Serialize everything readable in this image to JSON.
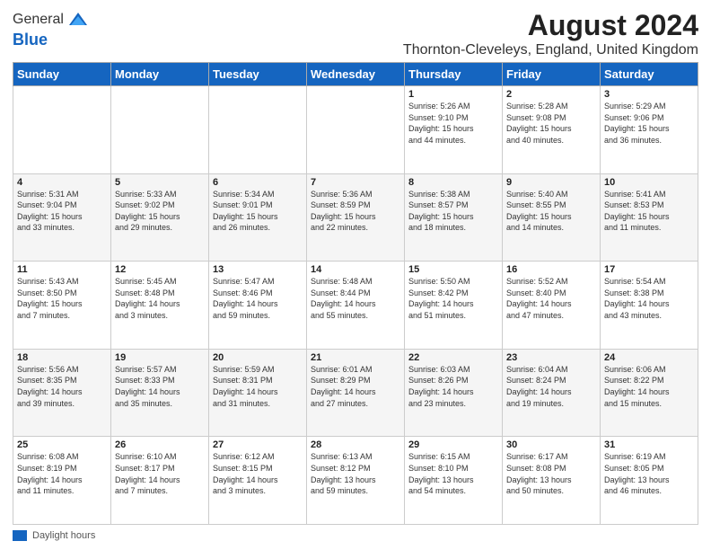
{
  "logo": {
    "general": "General",
    "blue": "Blue"
  },
  "header": {
    "title": "August 2024",
    "subtitle": "Thornton-Cleveleys, England, United Kingdom"
  },
  "days_of_week": [
    "Sunday",
    "Monday",
    "Tuesday",
    "Wednesday",
    "Thursday",
    "Friday",
    "Saturday"
  ],
  "footer": {
    "label": "Daylight hours"
  },
  "weeks": [
    {
      "days": [
        {
          "num": "",
          "info": ""
        },
        {
          "num": "",
          "info": ""
        },
        {
          "num": "",
          "info": ""
        },
        {
          "num": "",
          "info": ""
        },
        {
          "num": "1",
          "info": "Sunrise: 5:26 AM\nSunset: 9:10 PM\nDaylight: 15 hours\nand 44 minutes."
        },
        {
          "num": "2",
          "info": "Sunrise: 5:28 AM\nSunset: 9:08 PM\nDaylight: 15 hours\nand 40 minutes."
        },
        {
          "num": "3",
          "info": "Sunrise: 5:29 AM\nSunset: 9:06 PM\nDaylight: 15 hours\nand 36 minutes."
        }
      ]
    },
    {
      "days": [
        {
          "num": "4",
          "info": "Sunrise: 5:31 AM\nSunset: 9:04 PM\nDaylight: 15 hours\nand 33 minutes."
        },
        {
          "num": "5",
          "info": "Sunrise: 5:33 AM\nSunset: 9:02 PM\nDaylight: 15 hours\nand 29 minutes."
        },
        {
          "num": "6",
          "info": "Sunrise: 5:34 AM\nSunset: 9:01 PM\nDaylight: 15 hours\nand 26 minutes."
        },
        {
          "num": "7",
          "info": "Sunrise: 5:36 AM\nSunset: 8:59 PM\nDaylight: 15 hours\nand 22 minutes."
        },
        {
          "num": "8",
          "info": "Sunrise: 5:38 AM\nSunset: 8:57 PM\nDaylight: 15 hours\nand 18 minutes."
        },
        {
          "num": "9",
          "info": "Sunrise: 5:40 AM\nSunset: 8:55 PM\nDaylight: 15 hours\nand 14 minutes."
        },
        {
          "num": "10",
          "info": "Sunrise: 5:41 AM\nSunset: 8:53 PM\nDaylight: 15 hours\nand 11 minutes."
        }
      ]
    },
    {
      "days": [
        {
          "num": "11",
          "info": "Sunrise: 5:43 AM\nSunset: 8:50 PM\nDaylight: 15 hours\nand 7 minutes."
        },
        {
          "num": "12",
          "info": "Sunrise: 5:45 AM\nSunset: 8:48 PM\nDaylight: 14 hours\nand 3 minutes."
        },
        {
          "num": "13",
          "info": "Sunrise: 5:47 AM\nSunset: 8:46 PM\nDaylight: 14 hours\nand 59 minutes."
        },
        {
          "num": "14",
          "info": "Sunrise: 5:48 AM\nSunset: 8:44 PM\nDaylight: 14 hours\nand 55 minutes."
        },
        {
          "num": "15",
          "info": "Sunrise: 5:50 AM\nSunset: 8:42 PM\nDaylight: 14 hours\nand 51 minutes."
        },
        {
          "num": "16",
          "info": "Sunrise: 5:52 AM\nSunset: 8:40 PM\nDaylight: 14 hours\nand 47 minutes."
        },
        {
          "num": "17",
          "info": "Sunrise: 5:54 AM\nSunset: 8:38 PM\nDaylight: 14 hours\nand 43 minutes."
        }
      ]
    },
    {
      "days": [
        {
          "num": "18",
          "info": "Sunrise: 5:56 AM\nSunset: 8:35 PM\nDaylight: 14 hours\nand 39 minutes."
        },
        {
          "num": "19",
          "info": "Sunrise: 5:57 AM\nSunset: 8:33 PM\nDaylight: 14 hours\nand 35 minutes."
        },
        {
          "num": "20",
          "info": "Sunrise: 5:59 AM\nSunset: 8:31 PM\nDaylight: 14 hours\nand 31 minutes."
        },
        {
          "num": "21",
          "info": "Sunrise: 6:01 AM\nSunset: 8:29 PM\nDaylight: 14 hours\nand 27 minutes."
        },
        {
          "num": "22",
          "info": "Sunrise: 6:03 AM\nSunset: 8:26 PM\nDaylight: 14 hours\nand 23 minutes."
        },
        {
          "num": "23",
          "info": "Sunrise: 6:04 AM\nSunset: 8:24 PM\nDaylight: 14 hours\nand 19 minutes."
        },
        {
          "num": "24",
          "info": "Sunrise: 6:06 AM\nSunset: 8:22 PM\nDaylight: 14 hours\nand 15 minutes."
        }
      ]
    },
    {
      "days": [
        {
          "num": "25",
          "info": "Sunrise: 6:08 AM\nSunset: 8:19 PM\nDaylight: 14 hours\nand 11 minutes."
        },
        {
          "num": "26",
          "info": "Sunrise: 6:10 AM\nSunset: 8:17 PM\nDaylight: 14 hours\nand 7 minutes."
        },
        {
          "num": "27",
          "info": "Sunrise: 6:12 AM\nSunset: 8:15 PM\nDaylight: 14 hours\nand 3 minutes."
        },
        {
          "num": "28",
          "info": "Sunrise: 6:13 AM\nSunset: 8:12 PM\nDaylight: 13 hours\nand 59 minutes."
        },
        {
          "num": "29",
          "info": "Sunrise: 6:15 AM\nSunset: 8:10 PM\nDaylight: 13 hours\nand 54 minutes."
        },
        {
          "num": "30",
          "info": "Sunrise: 6:17 AM\nSunset: 8:08 PM\nDaylight: 13 hours\nand 50 minutes."
        },
        {
          "num": "31",
          "info": "Sunrise: 6:19 AM\nSunset: 8:05 PM\nDaylight: 13 hours\nand 46 minutes."
        }
      ]
    }
  ]
}
